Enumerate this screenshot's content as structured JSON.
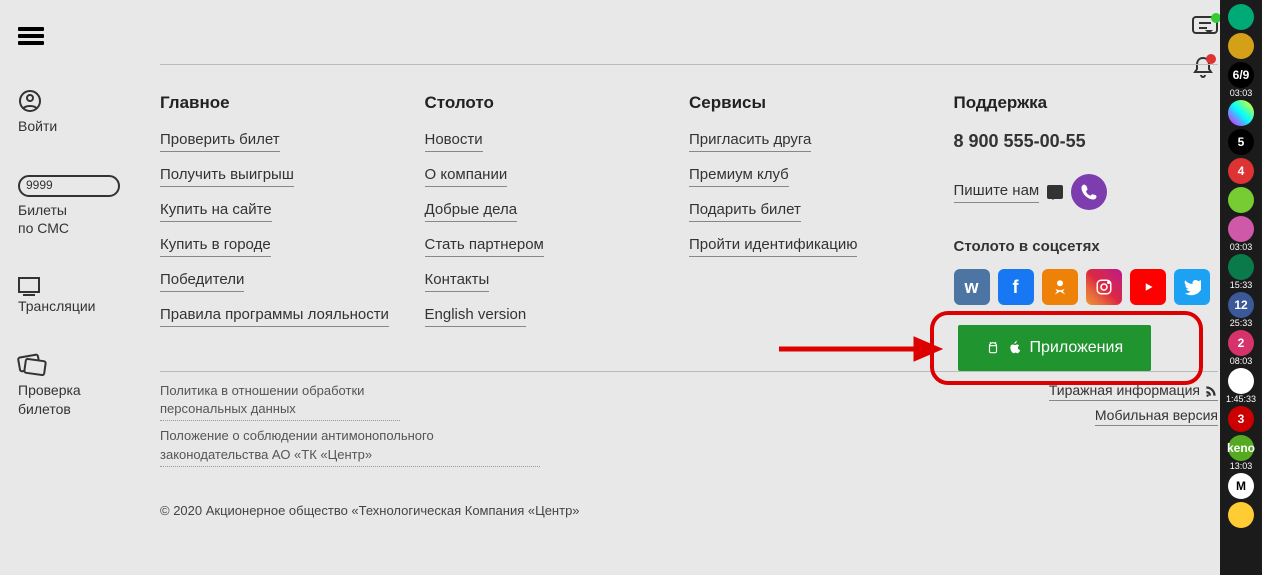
{
  "left_nav": {
    "login": "Войти",
    "tickets_line1": "Билеты",
    "tickets_line2": "по СМС",
    "tickets_badge": "9999",
    "broadcasts": "Трансляции",
    "check_line1": "Проверка",
    "check_line2": "билетов"
  },
  "footer": {
    "col1": {
      "title": "Главное",
      "links": [
        "Проверить билет",
        "Получить выигрыш",
        "Купить на сайте",
        "Купить в городе",
        "Победители",
        "Правила программы лояльности"
      ]
    },
    "col2": {
      "title": "Столото",
      "links": [
        "Новости",
        "О компании",
        "Добрые дела",
        "Стать партнером",
        "Контакты",
        "English version"
      ]
    },
    "col3": {
      "title": "Сервисы",
      "links": [
        "Пригласить друга",
        "Премиум клуб",
        "Подарить билет",
        "Пройти идентификацию"
      ]
    },
    "col4": {
      "title": "Поддержка",
      "phone": "8 900 555-00-55",
      "write": "Пишите нам",
      "socials_heading": "Столото в соцсетях",
      "app_button": "Приложения"
    }
  },
  "bottom": {
    "policy1": "Политика в отношении обработки персональных данных",
    "policy2": "Положение о соблюдении антимонопольного законодательства АО «ТК «Центр»",
    "draw_info": "Тиражная информация",
    "mobile": "Мобильная версия",
    "copyright": "© 2020 Акционерное общество «Технологическая Компания «Центр»"
  },
  "rail": [
    {
      "bg": "#0a7",
      "txt": "",
      "time": ""
    },
    {
      "bg": "#d4a017",
      "txt": "",
      "time": ""
    },
    {
      "bg": "#000",
      "txt": "6/9",
      "time": "03:03"
    },
    {
      "bg": "linear-gradient(45deg,#f0f,#0ff,#ff0)",
      "txt": "",
      "time": ""
    },
    {
      "bg": "#000",
      "txt": "5",
      "time": ""
    },
    {
      "bg": "#d33",
      "txt": "4",
      "time": ""
    },
    {
      "bg": "#7c3",
      "txt": "",
      "time": ""
    },
    {
      "bg": "#d058a8",
      "txt": "",
      "time": "03:03"
    },
    {
      "bg": "#0a7a4a",
      "txt": "",
      "time": "15:33"
    },
    {
      "bg": "#3b5998",
      "txt": "12",
      "time": "25:33"
    },
    {
      "bg": "#d6336c",
      "txt": "2",
      "time": "08:03"
    },
    {
      "bg": "#fff",
      "txt": "",
      "time": "1:45:33",
      "dark": true
    },
    {
      "bg": "#c00",
      "txt": "3",
      "time": ""
    },
    {
      "bg": "#5a2",
      "txt": "keno",
      "time": "13:03"
    },
    {
      "bg": "#fff",
      "txt": "M",
      "time": "",
      "dark": true
    },
    {
      "bg": "#fc3",
      "txt": "",
      "time": ""
    }
  ]
}
